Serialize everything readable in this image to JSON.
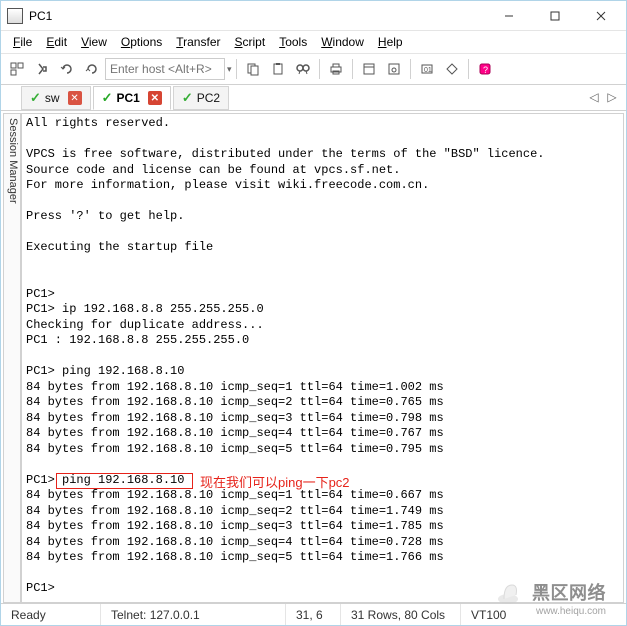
{
  "window": {
    "title": "PC1"
  },
  "menubar": {
    "items": [
      {
        "u": "F",
        "rest": "ile"
      },
      {
        "u": "E",
        "rest": "dit"
      },
      {
        "u": "V",
        "rest": "iew"
      },
      {
        "u": "O",
        "rest": "ptions"
      },
      {
        "u": "T",
        "rest": "ransfer"
      },
      {
        "u": "S",
        "rest": "cript"
      },
      {
        "u": "T",
        "rest": "ools"
      },
      {
        "u": "W",
        "rest": "indow"
      },
      {
        "u": "H",
        "rest": "elp"
      }
    ]
  },
  "toolbar": {
    "host_placeholder": "Enter host <Alt+R>"
  },
  "tabs": {
    "items": [
      {
        "label": "sw",
        "active": false,
        "closable": true
      },
      {
        "label": "PC1",
        "active": true,
        "closable": true
      },
      {
        "label": "PC2",
        "active": false,
        "closable": false
      }
    ]
  },
  "sidetab_label": "Session Manager",
  "terminal_lines": [
    "All rights reserved.",
    "",
    "VPCS is free software, distributed under the terms of the \"BSD\" licence.",
    "Source code and license can be found at vpcs.sf.net.",
    "For more information, please visit wiki.freecode.com.cn.",
    "",
    "Press '?' to get help.",
    "",
    "Executing the startup file",
    "",
    "",
    "PC1>",
    "PC1> ip 192.168.8.8 255.255.255.0",
    "Checking for duplicate address...",
    "PC1 : 192.168.8.8 255.255.255.0",
    "",
    "PC1> ping 192.168.8.10",
    "84 bytes from 192.168.8.10 icmp_seq=1 ttl=64 time=1.002 ms",
    "84 bytes from 192.168.8.10 icmp_seq=2 ttl=64 time=0.765 ms",
    "84 bytes from 192.168.8.10 icmp_seq=3 ttl=64 time=0.798 ms",
    "84 bytes from 192.168.8.10 icmp_seq=4 ttl=64 time=0.767 ms",
    "84 bytes from 192.168.8.10 icmp_seq=5 ttl=64 time=0.795 ms",
    "",
    "PC1> ping 192.168.8.10",
    "84 bytes from 192.168.8.10 icmp_seq=1 ttl=64 time=0.667 ms",
    "84 bytes from 192.168.8.10 icmp_seq=2 ttl=64 time=1.749 ms",
    "84 bytes from 192.168.8.10 icmp_seq=3 ttl=64 time=1.785 ms",
    "84 bytes from 192.168.8.10 icmp_seq=4 ttl=64 time=0.728 ms",
    "84 bytes from 192.168.8.10 icmp_seq=5 ttl=64 time=1.766 ms",
    "",
    "PC1>"
  ],
  "annotation_text": "现在我们可以ping一下pc2",
  "statusbar": {
    "ready": "Ready",
    "conn": "Telnet: 127.0.0.1",
    "pos": "31,  6",
    "size": "31 Rows, 80 Cols",
    "term": "VT100"
  },
  "watermark": {
    "main": "黑区网络",
    "sub": "www.heiqu.com"
  }
}
